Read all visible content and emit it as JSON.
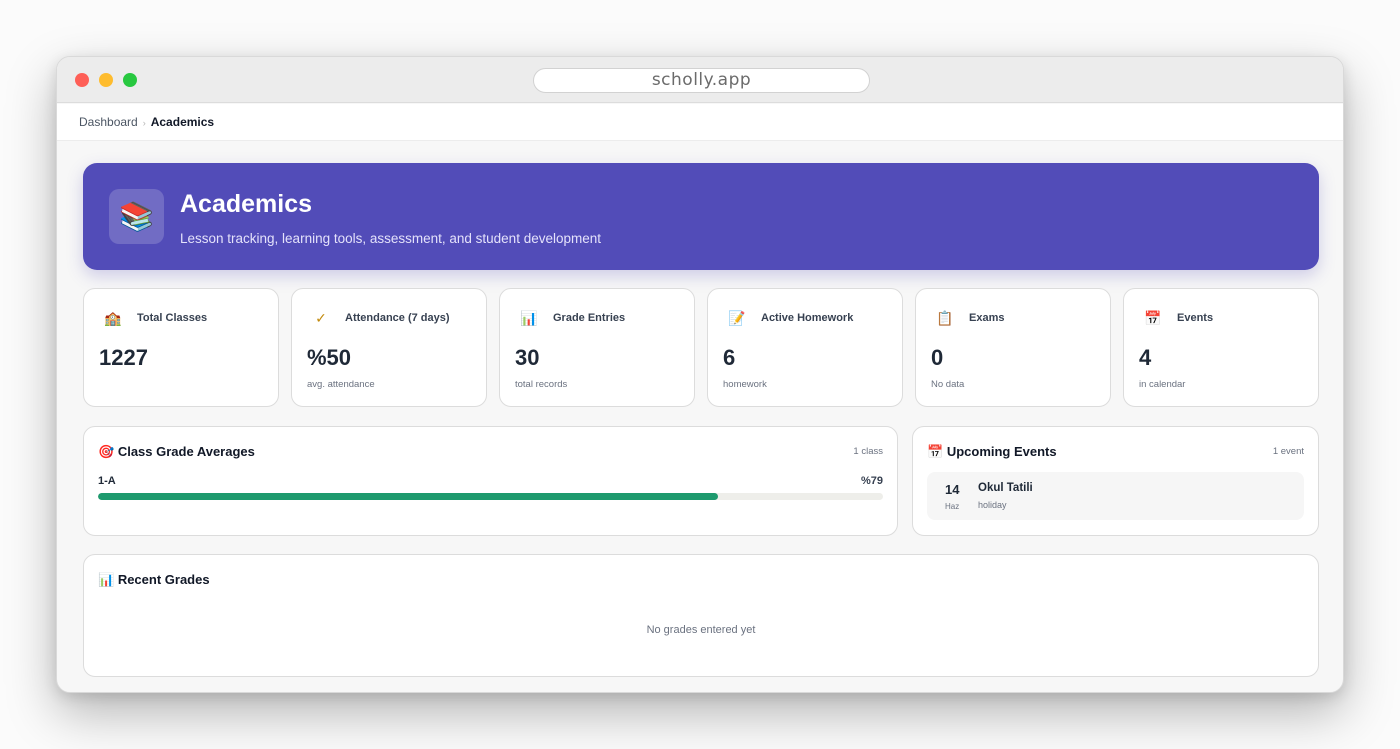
{
  "browser": {
    "url": "scholly.app"
  },
  "breadcrumb": {
    "parent": "Dashboard",
    "separator": "›",
    "current": "Academics"
  },
  "hero": {
    "icon": "📚",
    "icon_name": "books-icon",
    "title": "Academics",
    "subtitle": "Lesson tracking, learning tools, assessment, and student development",
    "color": "#524cb8"
  },
  "stats": [
    {
      "icon": "🏫",
      "icon_name": "school-icon",
      "label": "Total Classes",
      "value": "1227",
      "sub": ""
    },
    {
      "icon": "✓",
      "icon_name": "checkmark-icon",
      "label": "Attendance (7 days)",
      "value": "%50",
      "sub": "avg. attendance"
    },
    {
      "icon": "📊",
      "icon_name": "bar-chart-icon",
      "label": "Grade Entries",
      "value": "30",
      "sub": "total records"
    },
    {
      "icon": "📝",
      "icon_name": "memo-icon",
      "label": "Active Homework",
      "value": "6",
      "sub": "homework"
    },
    {
      "icon": "📋",
      "icon_name": "clipboard-icon",
      "label": "Exams",
      "value": "0",
      "sub": "No data"
    },
    {
      "icon": "📅",
      "icon_name": "calendar-icon",
      "label": "Events",
      "value": "4",
      "sub": "in calendar"
    }
  ],
  "class_grades": {
    "icon": "🎯",
    "title": "Class Grade Averages",
    "meta": "1 class",
    "items": [
      {
        "name": "1-A",
        "percent_label": "%79",
        "percent": 79
      }
    ],
    "bar_color": "#1e9a6e"
  },
  "upcoming_events": {
    "icon": "📅",
    "title": "Upcoming Events",
    "meta": "1 event",
    "items": [
      {
        "day": "14",
        "month": "Haz",
        "name": "Okul Tatili",
        "type": "holiday"
      }
    ]
  },
  "recent_grades": {
    "icon": "📊",
    "title": "Recent Grades",
    "empty_message": "No grades entered yet"
  }
}
